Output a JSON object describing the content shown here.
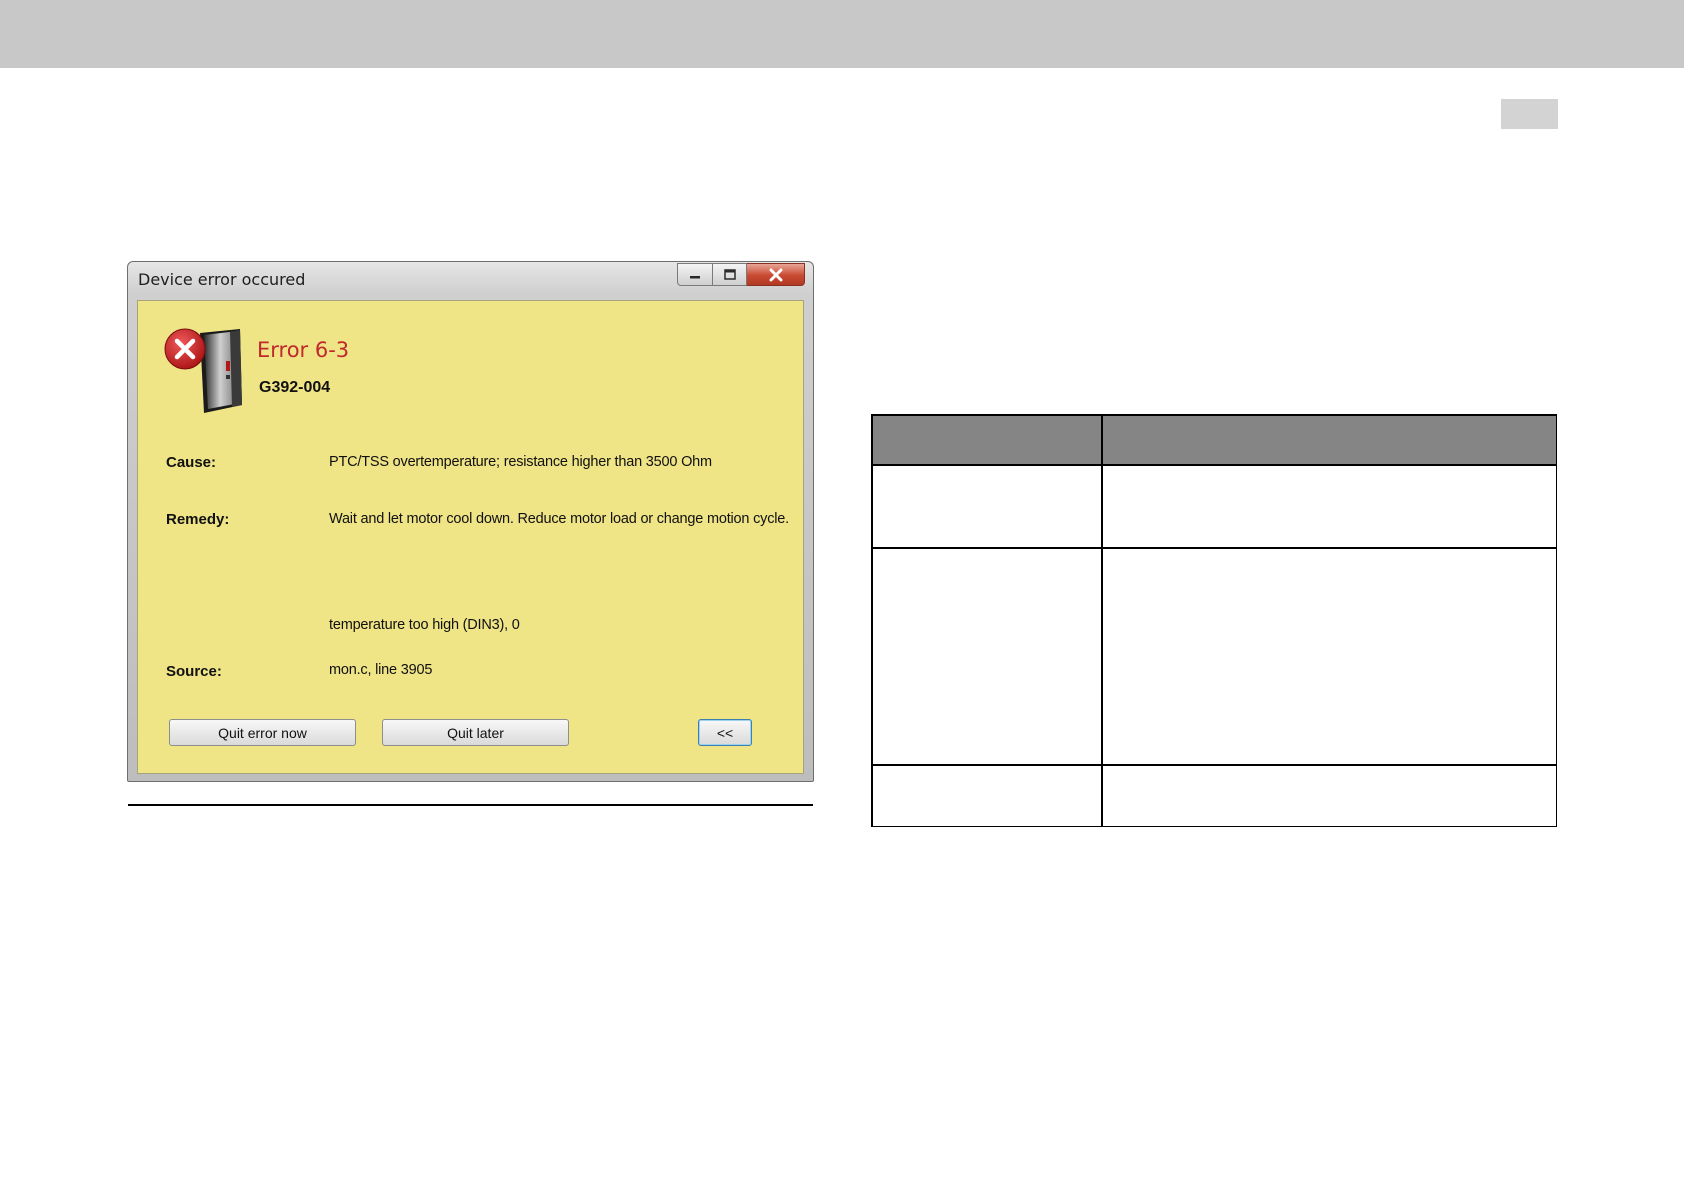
{
  "dialog": {
    "title": "Device error occured",
    "window_buttons": {
      "minimize": "minimize-icon",
      "maximize": "maximize-icon",
      "close": "close-icon"
    },
    "error_title": "Error 6-3",
    "device_id": "G392-004",
    "cause_label": "Cause:",
    "cause_text": "PTC/TSS overtemperature; resistance higher than 3500 Ohm",
    "remedy_label": "Remedy:",
    "remedy_text": "Wait and let motor cool down. Reduce motor load or change motion cycle.",
    "extra_text": "temperature too high (DIN3), 0",
    "source_label": "Source:",
    "source_text": "mon.c, line 3905",
    "buttons": {
      "quit_now": "Quit error now",
      "quit_later": "Quit later",
      "toggle": "<<"
    },
    "colors": {
      "body_bg": "#efe486",
      "error_red": "#c0282c"
    }
  },
  "table": {
    "header_color": "#858585",
    "rows": 3
  }
}
